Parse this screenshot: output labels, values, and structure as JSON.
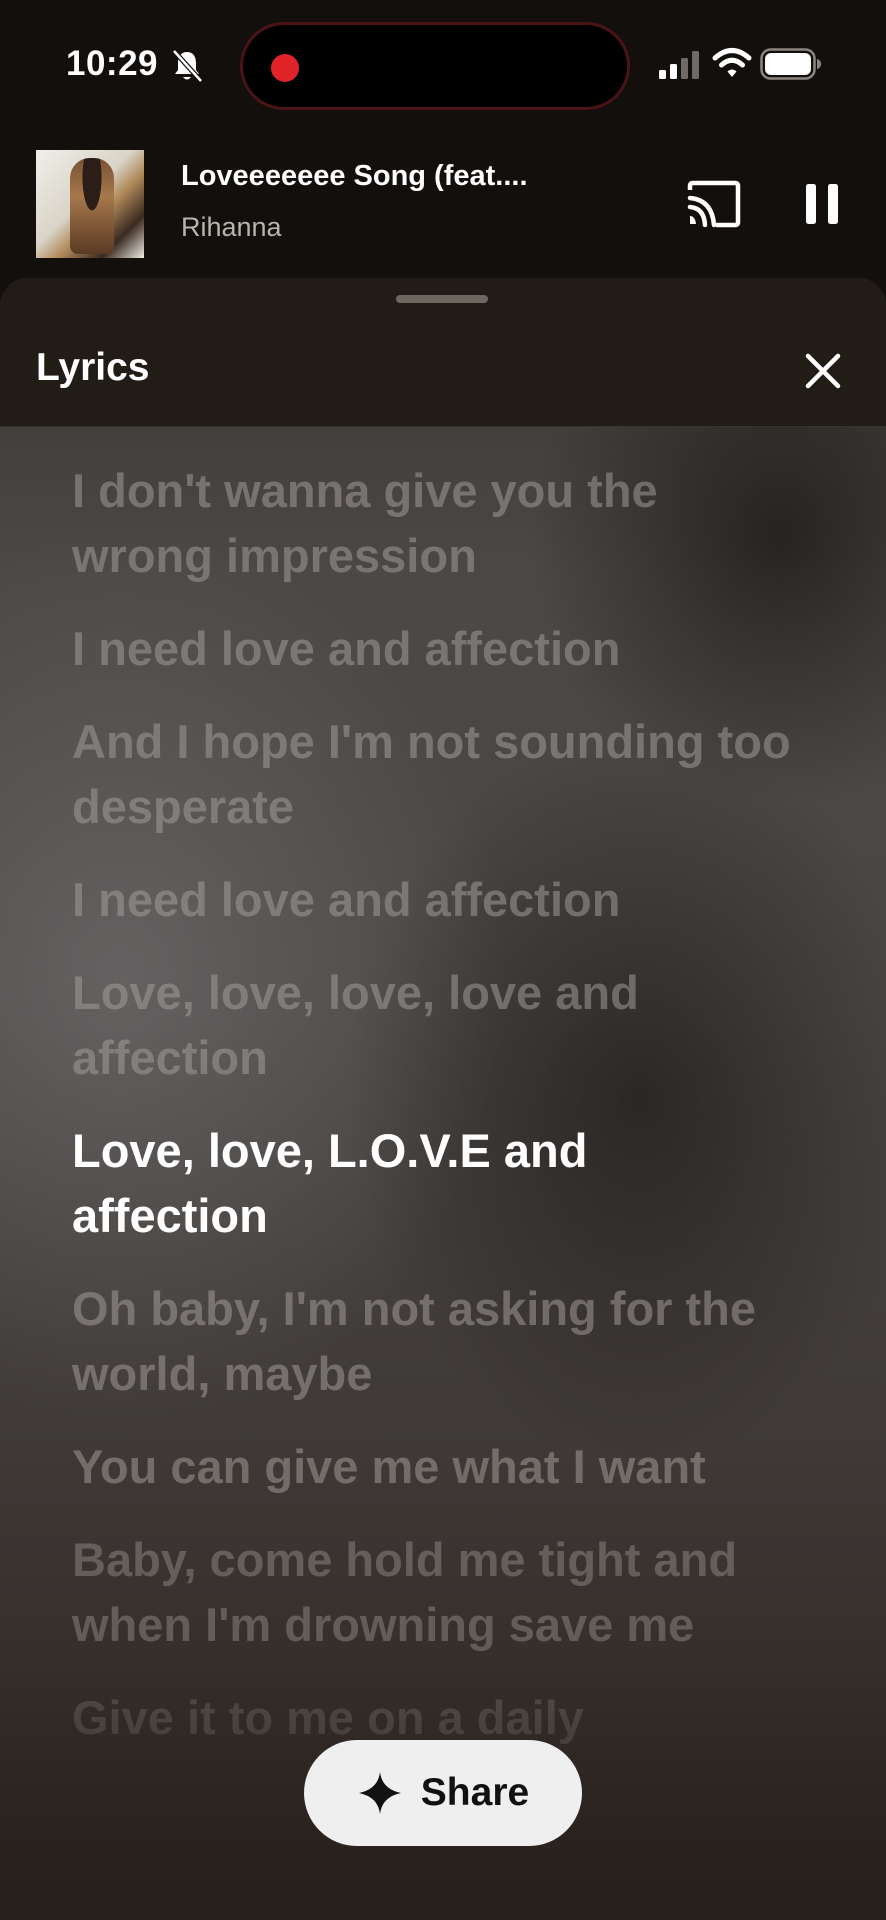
{
  "status_bar": {
    "time": "10:29"
  },
  "now_playing": {
    "title": "Loveeeeeee Song (feat....",
    "artist": "Rihanna"
  },
  "lyrics_sheet": {
    "title": "Lyrics",
    "lines": [
      {
        "text": "I don't wanna give you the wrong impression",
        "state": "past"
      },
      {
        "text": "I need love and affection",
        "state": "past"
      },
      {
        "text": "And I hope I'm not sounding too desperate",
        "state": "past"
      },
      {
        "text": "I need love and affection",
        "state": "past"
      },
      {
        "text": "Love, love, love, love and affection",
        "state": "past"
      },
      {
        "text": "Love, love, L.O.V.E and affection",
        "state": "current"
      },
      {
        "text": "Oh baby, I'm not asking for the world, maybe",
        "state": "upcoming"
      },
      {
        "text": "You can give me what I want",
        "state": "upcoming"
      },
      {
        "text": "Baby, come hold me tight and when I'm drowning save me",
        "state": "upcoming"
      },
      {
        "text": "Give it to me on a daily",
        "state": "upcoming"
      }
    ],
    "share_label": "Share"
  },
  "colors": {
    "active_lyric": "#ffffff",
    "inactive_lyric": "#a5a09c",
    "recording_dot": "#e0242a",
    "share_button_bg": "#efefef"
  },
  "icons": [
    "bell-slash-icon",
    "cellular-signal-icon",
    "wifi-icon",
    "battery-icon",
    "cast-icon",
    "pause-icon",
    "close-icon",
    "sparkle-icon"
  ]
}
